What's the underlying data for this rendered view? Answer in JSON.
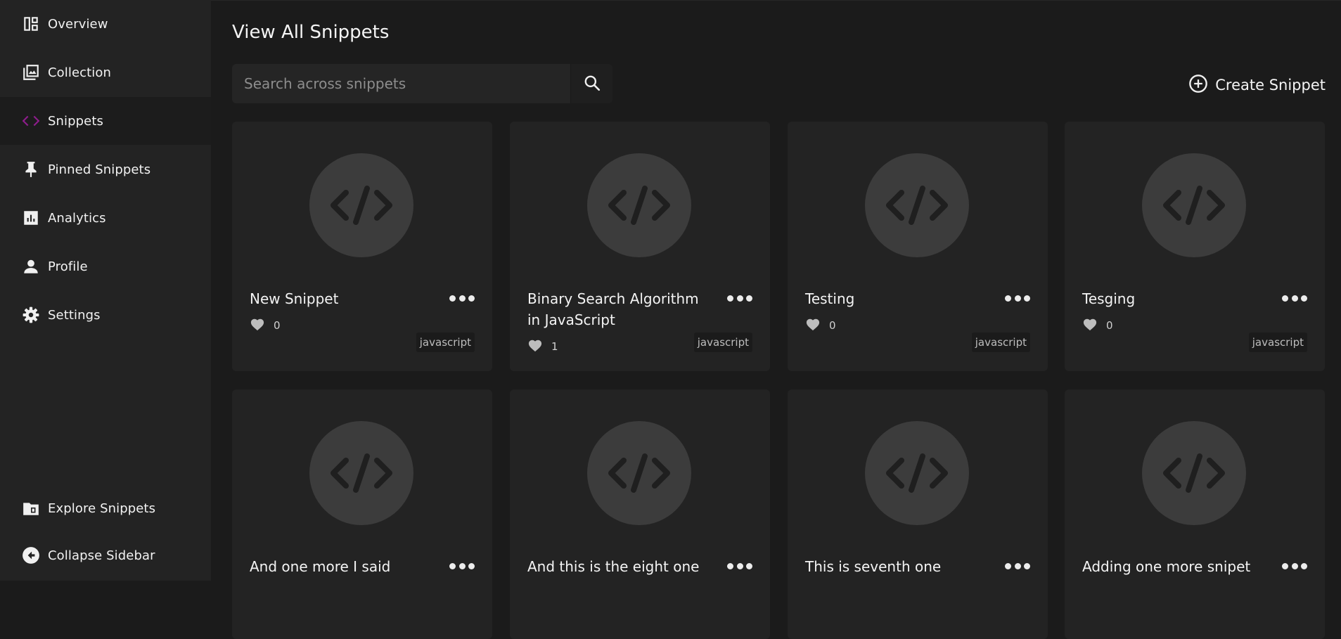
{
  "sidebar": {
    "top_items": [
      {
        "label": "Overview",
        "icon": "dashboard-icon",
        "active": false
      },
      {
        "label": "Collection",
        "icon": "collection-icon",
        "active": false
      },
      {
        "label": "Snippets",
        "icon": "code-icon",
        "active": true
      },
      {
        "label": "Pinned Snippets",
        "icon": "pin-icon",
        "active": false
      },
      {
        "label": "Analytics",
        "icon": "analytics-icon",
        "active": false
      },
      {
        "label": "Profile",
        "icon": "person-icon",
        "active": false
      },
      {
        "label": "Settings",
        "icon": "gear-icon",
        "active": false
      }
    ],
    "bottom_items": [
      {
        "label": "Explore Snippets",
        "icon": "folder-icon"
      },
      {
        "label": "Collapse Sidebar",
        "icon": "collapse-icon"
      }
    ],
    "accent_color": "#8e1d8c"
  },
  "main": {
    "title": "View All Snippets",
    "search": {
      "placeholder": "Search across snippets",
      "value": ""
    },
    "create_label": "Create Snippet"
  },
  "snippets": [
    {
      "title": "New Snippet",
      "likes": "0",
      "language": "javascript"
    },
    {
      "title": "Binary Search Algorithm in JavaScript",
      "likes": "1",
      "language": "javascript"
    },
    {
      "title": "Testing",
      "likes": "0",
      "language": "javascript"
    },
    {
      "title": "Tesging",
      "likes": "0",
      "language": "javascript"
    },
    {
      "title": "And one more I said",
      "likes": "",
      "language": ""
    },
    {
      "title": "And this is the eight one",
      "likes": "",
      "language": ""
    },
    {
      "title": "This is seventh one",
      "likes": "",
      "language": ""
    },
    {
      "title": "Adding one more snipet",
      "likes": "",
      "language": ""
    }
  ]
}
